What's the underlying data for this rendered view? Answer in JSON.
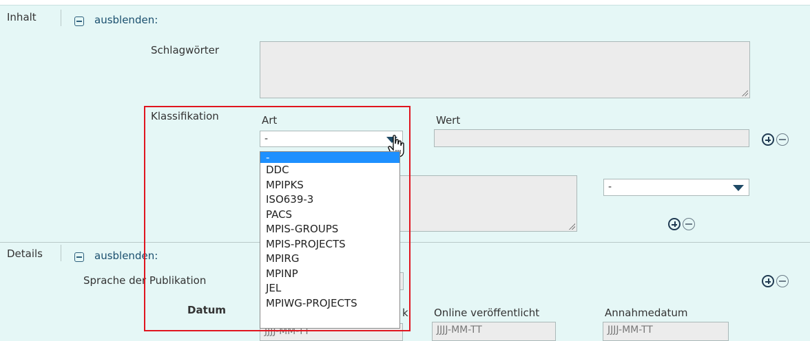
{
  "sections": {
    "inhalt": {
      "label": "Inhalt",
      "toggle": "ausblenden:"
    },
    "details": {
      "label": "Details",
      "toggle": "ausblenden:"
    }
  },
  "fields": {
    "schlagwoerter": "Schlagwörter",
    "klassifikation": "Klassifikation",
    "art": "Art",
    "wert": "Wert",
    "art_value": "-",
    "second_select_value": "-",
    "sprache": "Sprache der Publikation",
    "datum": "Datum",
    "online": "Online veröffentlicht",
    "annahme": "Annahmedatum",
    "date_placeholder": "JJJJ-MM-TT",
    "obscured_label_tail": "k"
  },
  "dropdown": {
    "options": [
      "-",
      "DDC",
      "MPIPKS",
      "ISO639-3",
      "PACS",
      "MPIS-GROUPS",
      "MPIS-PROJECTS",
      "MPIRG",
      "MPINP",
      "JEL",
      "MPIWG-PROJECTS"
    ],
    "selected_index": 0
  },
  "colors": {
    "background": "#e5f7f6",
    "highlight": "#e0141e",
    "selected": "#1e90ff"
  },
  "icons": [
    "collapse-icon",
    "add-icon",
    "remove-icon",
    "chevron-down-icon",
    "hand-cursor-icon"
  ]
}
